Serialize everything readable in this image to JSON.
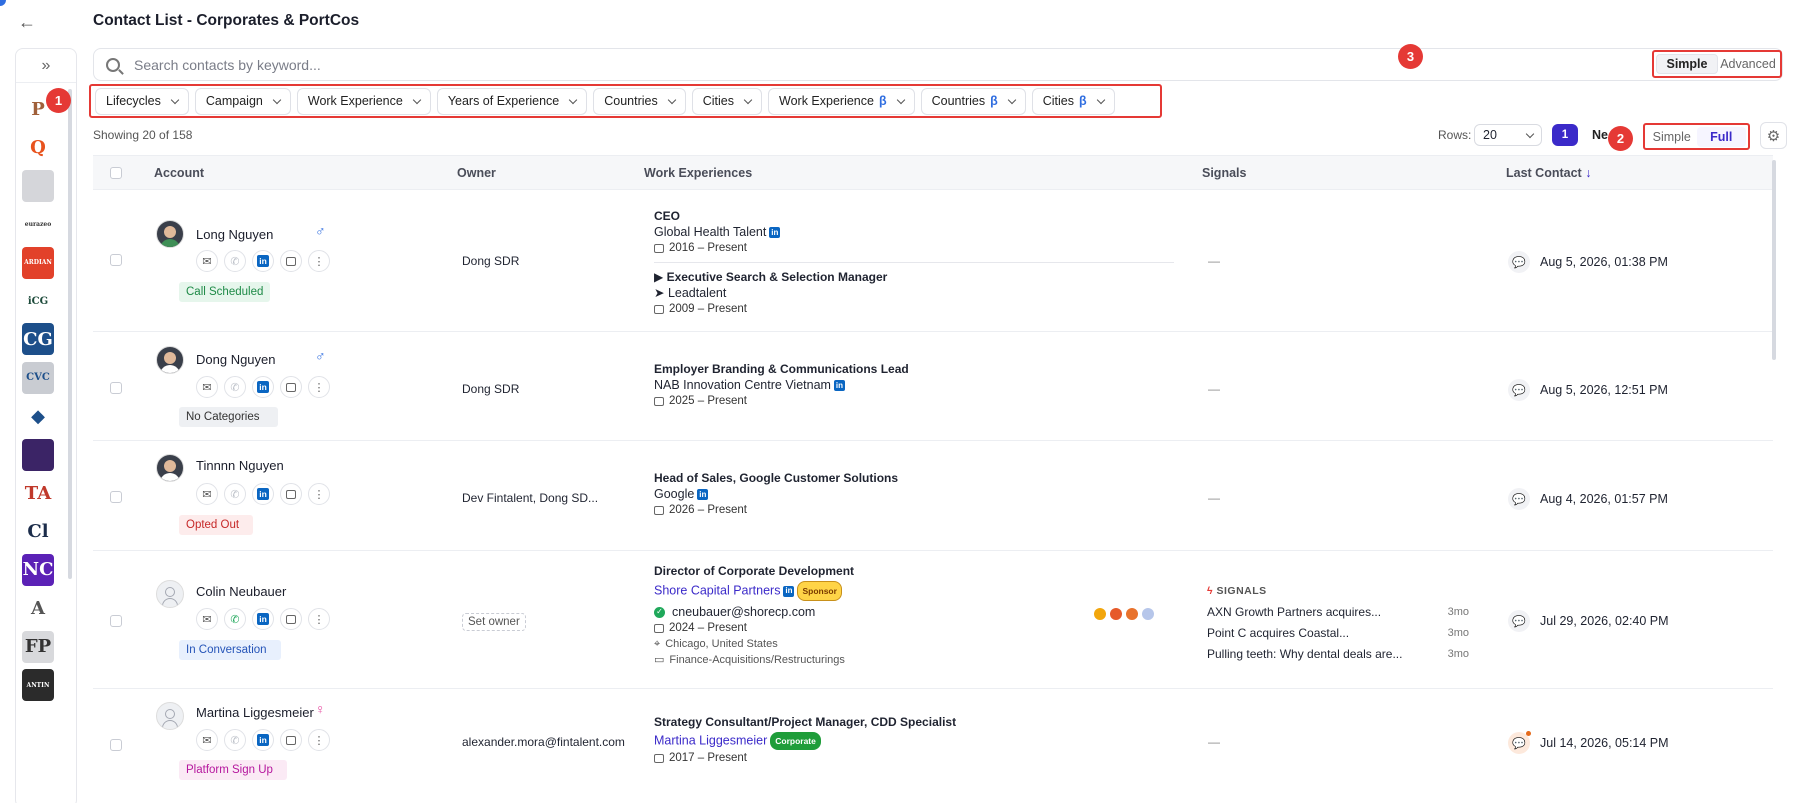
{
  "page": {
    "title": "Contact List - Corporates & PortCos"
  },
  "search": {
    "placeholder": "Search contacts by keyword..."
  },
  "mode_toggle": {
    "options": [
      "Simple",
      "Advanced"
    ],
    "selected": "Simple"
  },
  "view_toggle": {
    "options": [
      "Simple",
      "Full"
    ],
    "selected": "Full"
  },
  "callouts": [
    "1",
    "2",
    "3"
  ],
  "filters": [
    {
      "label": "Lifecycles",
      "beta": ""
    },
    {
      "label": "Campaign",
      "beta": ""
    },
    {
      "label": "Work Experience",
      "beta": ""
    },
    {
      "label": "Years of Experience",
      "beta": ""
    },
    {
      "label": "Countries",
      "beta": ""
    },
    {
      "label": "Cities",
      "beta": ""
    },
    {
      "label": "Work Experience",
      "beta": "β"
    },
    {
      "label": "Countries",
      "beta": "β"
    },
    {
      "label": "Cities",
      "beta": "β"
    }
  ],
  "pagination": {
    "showing": "Showing 20 of 158",
    "rows_label": "Rows:",
    "rows_value": "20",
    "current_page": "1",
    "next_label": "Ne"
  },
  "columns": {
    "account": "Account",
    "owner": "Owner",
    "work_experiences": "Work Experiences",
    "signals": "Signals",
    "last_contact": "Last Contact"
  },
  "sidebar_logos": [
    {
      "name": "P",
      "bg": "#ffffff",
      "fg": "#a0603a"
    },
    {
      "name": "Q",
      "bg": "#ffffff",
      "fg": "#e8531e"
    },
    {
      "name": "",
      "bg": "#d5d6da",
      "fg": "#555555"
    },
    {
      "name": "eurazeo",
      "bg": "#ffffff",
      "fg": "#333333"
    },
    {
      "name": "ARDIAN",
      "bg": "#e2412a",
      "fg": "#ffffff"
    },
    {
      "name": "iCG",
      "bg": "#ffffff",
      "fg": "#1c4a3a"
    },
    {
      "name": "CG",
      "bg": "#1d4f8a",
      "fg": "#ffffff"
    },
    {
      "name": "CVC",
      "bg": "#c9ccd2",
      "fg": "#1d4f8a"
    },
    {
      "name": "◆",
      "bg": "#ffffff",
      "fg": "#1d4f8a"
    },
    {
      "name": "",
      "bg": "#3b2466",
      "fg": "#ffffff"
    },
    {
      "name": "TA",
      "bg": "#ffffff",
      "fg": "#c0392b"
    },
    {
      "name": "Cl",
      "bg": "#ffffff",
      "fg": "#1b2c4a"
    },
    {
      "name": "NC",
      "bg": "#5b21b6",
      "fg": "#ffffff"
    },
    {
      "name": "A",
      "bg": "#ffffff",
      "fg": "#555555"
    },
    {
      "name": "FP",
      "bg": "#d8d9dc",
      "fg": "#333333"
    },
    {
      "name": "ANTIN",
      "bg": "#2b2b2b",
      "fg": "#ffffff"
    }
  ],
  "contacts": [
    {
      "name": "Long Nguyen",
      "gender": "♂",
      "gender_color": "#2f6de0",
      "tag": "Call Scheduled",
      "tag_bg": "#e6f6ec",
      "tag_fg": "#1e8a47",
      "owner": "Dong SDR",
      "signals_empty": "—",
      "last_contact": "Aug 5, 2026, 01:38 PM",
      "experiences": [
        {
          "role": "CEO",
          "company": "Global Health Talent",
          "dates": "2016 – Present"
        },
        {
          "role": "▶ Executive Search & Selection Manager",
          "company": "➤ Leadtalent",
          "dates": "2009 – Present"
        }
      ]
    },
    {
      "name": "Dong Nguyen",
      "gender": "♂",
      "gender_color": "#2f6de0",
      "tag": "No Categories",
      "tag_bg": "#eef0f3",
      "tag_fg": "#333333",
      "owner": "Dong SDR",
      "signals_empty": "—",
      "last_contact": "Aug 5, 2026, 12:51 PM",
      "experiences": [
        {
          "role": "Employer Branding & Communications Lead",
          "company": "NAB Innovation Centre Vietnam",
          "dates": "2025 – Present"
        }
      ]
    },
    {
      "name": "Tinnnn Nguyen",
      "gender": "",
      "gender_color": "#2f6de0",
      "tag": "Opted Out",
      "tag_bg": "#fdecec",
      "tag_fg": "#c62828",
      "owner": "Dev Fintalent, Dong SD...",
      "signals_empty": "—",
      "last_contact": "Aug 4, 2026, 01:57 PM",
      "experiences": [
        {
          "role": "Head of Sales, Google Customer Solutions",
          "company": "Google",
          "dates": "2026 – Present"
        }
      ]
    },
    {
      "name": "Colin Neubauer",
      "gender": "",
      "gender_color": "#2f6de0",
      "tag": "In Conversation",
      "tag_bg": "#e8f0fd",
      "tag_fg": "#2554b8",
      "owner": "Set owner",
      "last_contact": "Jul 29, 2026, 02:40 PM",
      "experience": {
        "role": "Director of Corporate Development",
        "company": "Shore Capital Partners",
        "badge": "Sponsor",
        "email": "cneubauer@shorecp.com",
        "dates": "2024 – Present",
        "location": "Chicago, United States",
        "department": "Finance-Acquisitions/Restructurings"
      },
      "signals": {
        "header": "SIGNALS",
        "items": [
          {
            "text": "AXN Growth Partners acquires...",
            "age": "3mo"
          },
          {
            "text": "Point C acquires Coastal...",
            "age": "3mo"
          },
          {
            "text": "Pulling teeth: Why dental deals are...",
            "age": "3mo"
          }
        ]
      }
    },
    {
      "name": "Martina Liggesmeier",
      "gender": "♀",
      "gender_color": "#e64aa0",
      "tag": "Platform Sign Up",
      "tag_bg": "#fbeaf5",
      "tag_fg": "#b5179e",
      "owner": "alexander.mora@fintalent.com",
      "signals_empty": "—",
      "last_contact": "Jul 14, 2026, 05:14 PM",
      "experience": {
        "role": "Strategy Consultant/Project Manager, CDD Specialist",
        "company": "Martina Liggesmeier",
        "badge": "Corporate",
        "dates": "2017 – Present"
      }
    }
  ]
}
